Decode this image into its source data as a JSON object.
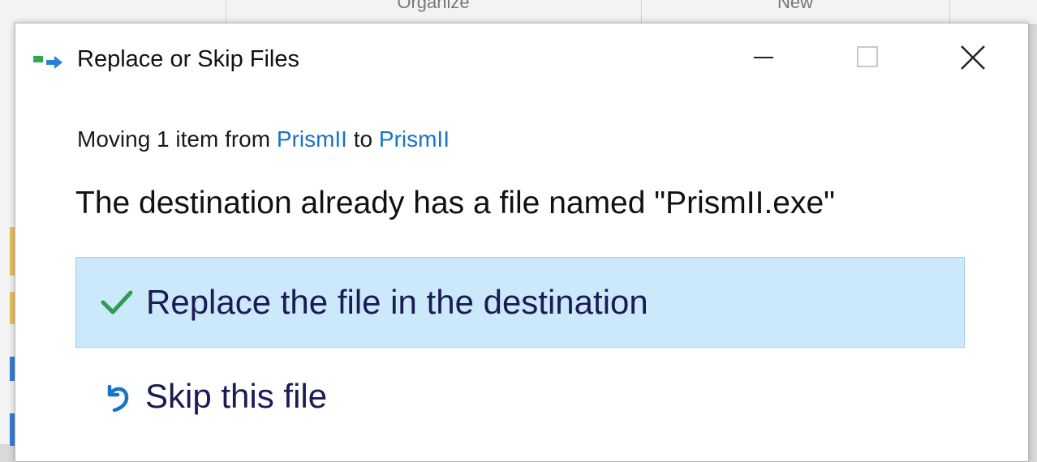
{
  "background": {
    "ribbon_groups": [
      "Organize",
      "New"
    ]
  },
  "dialog": {
    "title": "Replace or Skip Files",
    "subtitle": {
      "prefix": "Moving 1 item from ",
      "source": "PrismII",
      "middle": " to ",
      "destination": "PrismII"
    },
    "headline": "The destination already has a file named \"PrismII.exe\"",
    "options": [
      {
        "label": "Replace the file in the destination",
        "icon": "checkmark-icon",
        "selected": true
      },
      {
        "label": "Skip this file",
        "icon": "skip-undo-icon",
        "selected": false
      }
    ],
    "window_controls": [
      "minimize",
      "maximize",
      "close"
    ]
  },
  "colors": {
    "selected_bg": "#cce8fb",
    "selected_border": "#99d0f3",
    "link": "#1a73c8",
    "check": "#2e9e4f",
    "skip": "#1a73c8"
  }
}
